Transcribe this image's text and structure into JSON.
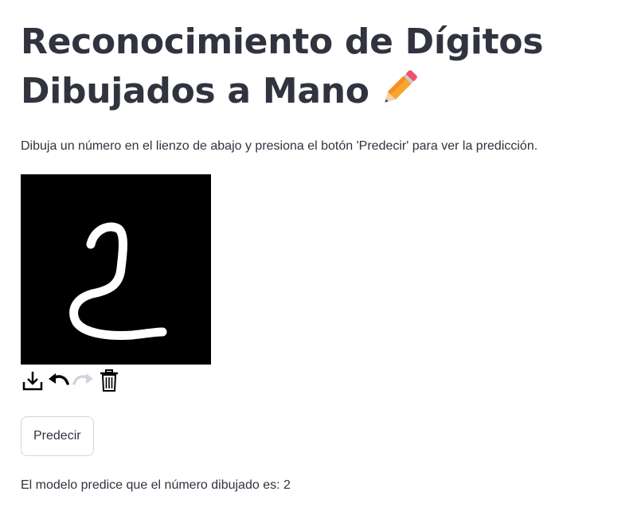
{
  "header": {
    "title": "Reconocimiento de Dígitos Dibujados a Mano",
    "title_emoji_icon": "pencil-icon"
  },
  "instructions": "Dibuja un número en el lienzo de abajo y presiona el botón 'Predecir' para ver la predicción.",
  "canvas": {
    "background_color": "#000000",
    "stroke_color": "#ffffff",
    "drawn_digit": "2"
  },
  "toolbar": {
    "tools": [
      {
        "name": "download-icon",
        "enabled": true
      },
      {
        "name": "undo-icon",
        "enabled": true
      },
      {
        "name": "redo-icon",
        "enabled": false
      },
      {
        "name": "trash-icon",
        "enabled": true
      }
    ]
  },
  "actions": {
    "predict_label": "Predecir"
  },
  "result": {
    "text": "El modelo predice que el número dibujado es: 2"
  },
  "colors": {
    "text": "#31333f",
    "button_border": "#d6d6d9",
    "disabled_icon": "#d0d5dd"
  }
}
